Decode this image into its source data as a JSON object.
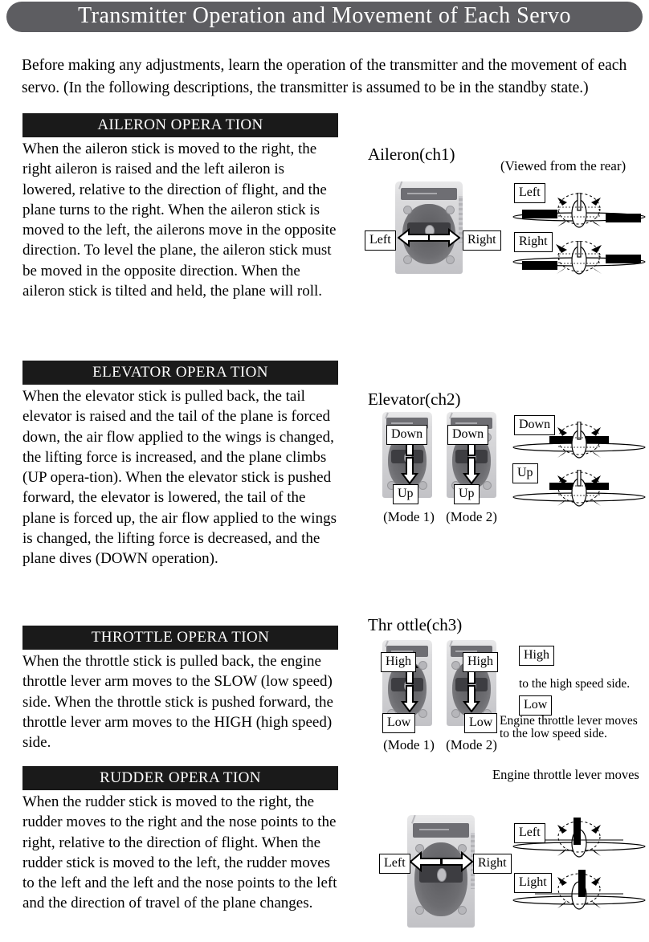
{
  "page": {
    "title": "Transmitter  Operation  and  Movement  of Each  Servo",
    "intro": "Before making any adjustments, learn the operation of the  transmitter and the movement of each servo. (In the following descriptions, the transmitter is assumed to be in the standby state.)"
  },
  "colors": {
    "title_bar_bg": "#5d5d61",
    "section_header_bg": "#1a1a1a",
    "text": "#000000",
    "paper": "#ffffff"
  },
  "sections": [
    {
      "id": "aileron",
      "header": "AILERON  OPERA TION",
      "body": "When the aileron stick is moved to the right, the right aileron is raised and the left aileron is lowered, relative to the direction of flight, and the plane turns to the right. When the aileron stick is moved to the left, the ailerons move in the opposite direction. To level the plane, the aileron stick must be moved in the opposite direction. When the aileron stick is tilted and held, the plane will roll."
    },
    {
      "id": "elevator",
      "header": "ELEVATOR  OPERA TION",
      "body": "When the elevator stick is pulled back, the tail elevator is raised and the tail of the plane is forced down, the air flow applied to the wings is changed, the lifting force is increased, and the plane climbs (UP opera-tion). When the elevator stick is pushed forward, the elevator is lowered, the tail of the plane is forced up, the air flow applied to the wings is changed, the lifting force is decreased, and the plane dives (DOWN operation)."
    },
    {
      "id": "throttle",
      "header": "THROTTLE   OPERA TION",
      "body": "When the throttle stick is pulled back, the engine throttle lever arm moves to the SLOW (low speed) side. When the throttle stick is pushed forward, the throttle lever arm moves to the HIGH (high speed) side."
    },
    {
      "id": "rudder",
      "header": "RUDDER  OPERA TION",
      "body": "When the rudder stick is moved to the right, the rudder moves to the right and the nose points to the right, relative to the direction of flight. When the rudder stick is moved to the left, the rudder moves to the left and the left and the nose points to the left and the direction of travel of the plane changes."
    }
  ],
  "diagrams": {
    "aileron": {
      "channel_title": "Aileron(ch1)",
      "view_note": "(Viewed from the rear)",
      "stick_left_label": "Left",
      "stick_right_label": "Right",
      "plane_top_label": "Left",
      "plane_bottom_label": "Right"
    },
    "elevator": {
      "channel_title": "Elevator(ch2)",
      "mode1_caption": "(Mode  1)",
      "mode2_caption": "(Mode  2)",
      "stick_up_label": "Down",
      "stick_down_label": "Up",
      "plane_top_label": "Down",
      "plane_bottom_label": "Up"
    },
    "throttle": {
      "channel_title": "Thr ottle(ch3)",
      "mode1_caption": "(Mode  1)",
      "mode2_caption": "(Mode  2)",
      "stick_up_label": "High",
      "stick_down_label": "Low",
      "note_high_label": "High",
      "note_high_text": "to the high speed side.",
      "note_low_label": "Low",
      "note_low_text_line1": "Engine throttle lever moves",
      "note_low_text_line2": "to the low speed side.",
      "note_trailing": "Engine throttle lever moves"
    },
    "rudder": {
      "stick_left_label": "Left",
      "stick_right_label": "Right",
      "plane_top_label": "Left",
      "plane_bottom_label": "Light"
    }
  }
}
